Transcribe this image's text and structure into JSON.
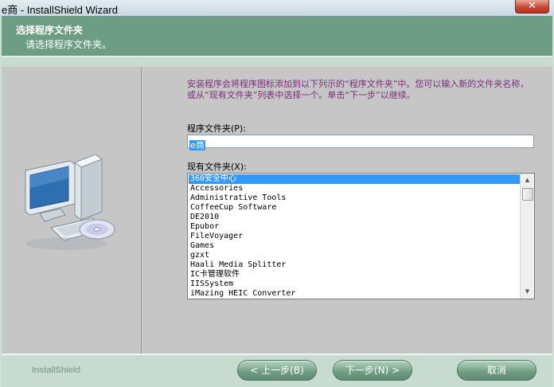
{
  "window": {
    "title": "e商 - InstallShield Wizard",
    "close_glyph": "✕"
  },
  "header": {
    "title": "选择程序文件夹",
    "subtitle": "请选择程序文件夹。"
  },
  "content": {
    "intro": "安装程序会将程序图标添加到以下列示的“程序文件夹”中。您可以输入新的文件夹名称，或从“现有文件夹”列表中选择一个。单击“下一步”以继续。",
    "folder_label": "程序文件夹(P):",
    "folder_value": "e商",
    "existing_label": "现有文件夹(X):",
    "existing_folders": [
      "360安全中心",
      "Accessories",
      "Administrative Tools",
      "CoffeeCup Software",
      "DE2010",
      "Epubor",
      "FileVoyager",
      "Games",
      "gzxt",
      "Haali Media Splitter",
      "IC卡管理软件",
      "IISSystem",
      "iMazing HEIC Converter"
    ],
    "selected_index": 0
  },
  "scrollbar": {
    "up_glyph": "▲",
    "down_glyph": "▼"
  },
  "footer": {
    "brand": "InstallShield",
    "back_label": "< 上一步(B)",
    "next_label": "下一步(N) >",
    "cancel_label": "取消"
  },
  "icons": {
    "illustration": "computer-cd-icon"
  }
}
